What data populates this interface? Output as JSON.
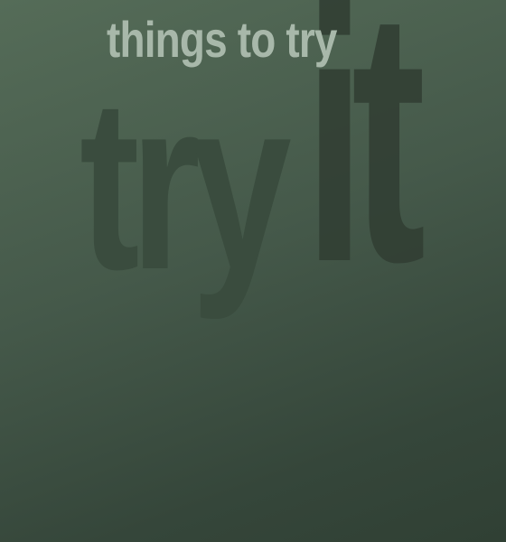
{
  "header": {
    "title": "things to try"
  },
  "artwork": {
    "word_one": "try",
    "word_two": "it"
  },
  "colors": {
    "background_top": "#556c58",
    "background_bottom": "#304034",
    "title_text": "#a8b8aa",
    "watermark_try": "#3a4c3e",
    "watermark_it": "#323f34"
  }
}
